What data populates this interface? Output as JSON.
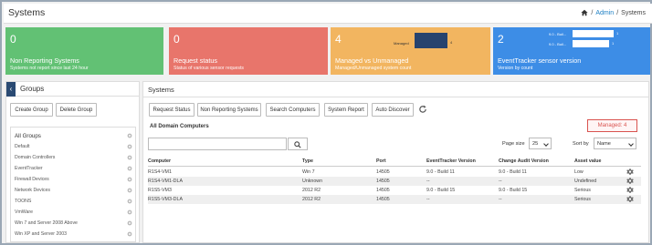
{
  "header": {
    "title": "Systems",
    "breadcrumb": [
      "Admin",
      "Systems"
    ],
    "separator": "/"
  },
  "tiles": [
    {
      "value": "0",
      "name": "Non Reporting Systems",
      "sub": "Systems not report since last 24 hour",
      "color": "#62c174"
    },
    {
      "value": "0",
      "name": "Request status",
      "sub": "Status of various sensor requests",
      "color": "#e8756b"
    },
    {
      "value": "4",
      "name": "Managed vs Unmanaged",
      "sub": "Managed/Unmanaged system count",
      "color": "#f2b560",
      "mini": {
        "label": "Managed",
        "marker": "4"
      }
    },
    {
      "value": "2",
      "name": "EventTracker sensor version",
      "sub": "Version by count",
      "color": "#3d8de6",
      "mini": {
        "labels": [
          "9.0 - Buil...",
          "9.0 - Buil..."
        ],
        "counts": [
          "1",
          "1"
        ]
      }
    }
  ],
  "groups_panel": {
    "title": "Groups",
    "create_label": "Create Group",
    "delete_label": "Delete Group",
    "items": [
      "All Groups",
      "Default",
      "Domain Controllers",
      "EventTracker",
      "Firewall Devices",
      "Network Devices",
      "TOONS",
      "VmWare",
      "Win 7 and Server 2008 Above",
      "Win XP and Server 2003"
    ]
  },
  "systems": {
    "title": "Systems",
    "toolbar": [
      "Request Status",
      "Non Reporting Systems",
      "Search Computers",
      "System Report",
      "Auto Discover"
    ],
    "section_title": "All Domain Computers",
    "managed_badge": "Managed: 4",
    "search_placeholder": "",
    "page_size_label": "Page size",
    "page_size": "25",
    "sort_label": "Sort by",
    "sort_value": "Name",
    "columns": [
      "Computer",
      "Type",
      "Port",
      "EventTracker Version",
      "Change Audit Version",
      "Asset value"
    ],
    "rows": [
      [
        "R1S4-VM1",
        "Win 7",
        "14505",
        "9.0 - Build 11",
        "9.0 - Build 11",
        "Low"
      ],
      [
        "R1S4-VM1-DLA",
        "Unknown",
        "14505",
        "--",
        "--",
        "Undefined"
      ],
      [
        "R1S5-VM3",
        "2012 R2",
        "14505",
        "9.0 - Build 15",
        "9.0 - Build 15",
        "Serious"
      ],
      [
        "R1S5-VM3-DLA",
        "2012 R2",
        "14505",
        "--",
        "--",
        "Serious"
      ]
    ]
  },
  "icons": {
    "home": "home-icon",
    "refresh": "refresh-icon",
    "search": "search-icon",
    "gear": "gear-icon",
    "collapse": "chevron-left-icon"
  }
}
